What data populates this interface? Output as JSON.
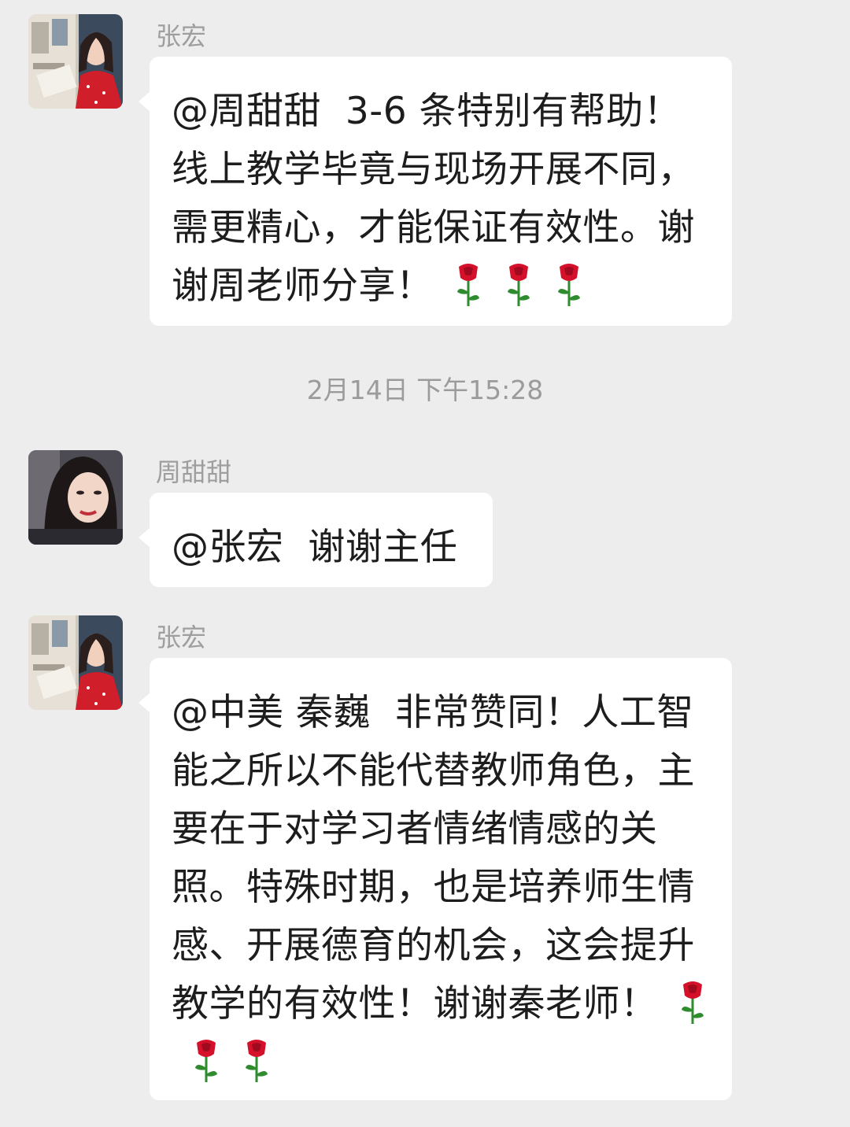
{
  "messages": [
    {
      "sender": "张宏",
      "avatar_icon": "avatar-zhanghong-icon",
      "text": "@周甜甜  3-6 条特别有帮助！线上教学毕竟与现场开展不同，需更精心，才能保证有效性。谢谢周老师分享！",
      "emoji": [
        "rose",
        "rose",
        "rose"
      ]
    },
    {
      "sender": "周甜甜",
      "avatar_icon": "avatar-zhoutiantian-icon",
      "text": "@张宏  谢谢主任",
      "emoji": []
    },
    {
      "sender": "张宏",
      "avatar_icon": "avatar-zhanghong-icon",
      "text": "@中美 秦巍  非常赞同！人工智能之所以不能代替教师角色，主要在于对学习者情绪情感的关照。特殊时期，也是培养师生情感、开展德育的机会，这会提升教学的有效性！谢谢秦老师！",
      "emoji": [
        "rose",
        "rose",
        "rose"
      ]
    }
  ],
  "timestamp": "2月14日 下午15:28",
  "colors": {
    "background": "#ededed",
    "bubble": "#ffffff",
    "name_text": "#9e9e9e",
    "message_text": "#1d1d1d",
    "rose_red": "#d4102a",
    "stem_green": "#2e8b2e"
  }
}
